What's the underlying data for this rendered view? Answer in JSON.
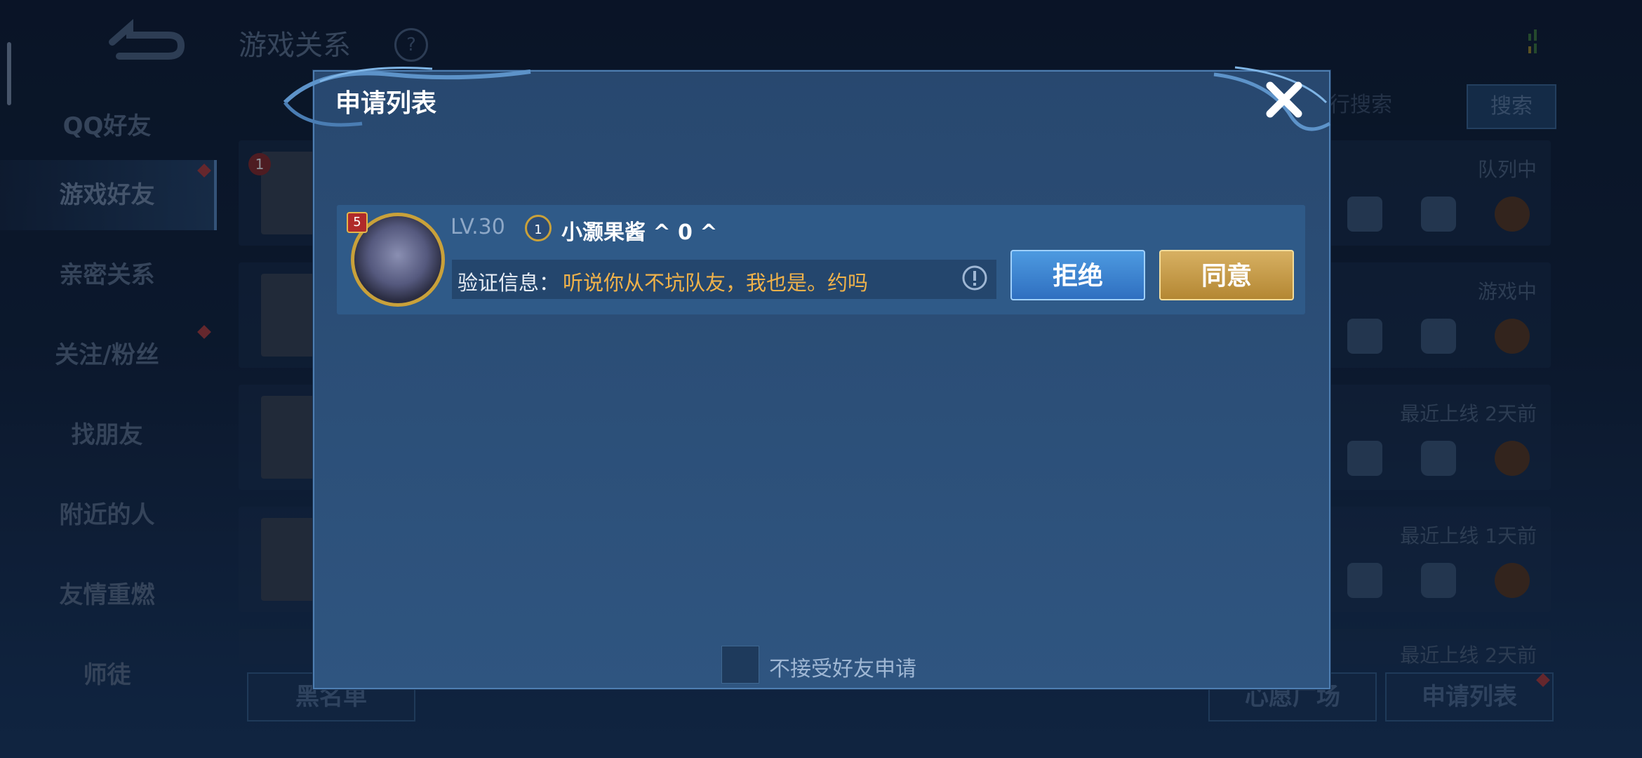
{
  "background": {
    "page_title": "游戏关系",
    "help_icon_text": "?",
    "sidebar": [
      {
        "label": "QQ好友"
      },
      {
        "label": "游戏好友",
        "active": true
      },
      {
        "label": "亲密关系"
      },
      {
        "label": "关注/粉丝"
      },
      {
        "label": "找朋友"
      },
      {
        "label": "附近的人"
      },
      {
        "label": "友情重燃"
      },
      {
        "label": "师徒"
      }
    ],
    "search_placeholder": "行搜索",
    "search_button": "搜索",
    "friend_rank_badge": "1",
    "friends": [
      {
        "status": "队列中"
      },
      {
        "status": "游戏中"
      },
      {
        "status": "最近上线  2天前"
      },
      {
        "status": "最近上线  1天前"
      },
      {
        "status": "最近上线  2天前"
      }
    ],
    "bottom_buttons": {
      "blacklist": "黑名单",
      "wish_square": "心愿广场",
      "apply_list": "申请列表"
    }
  },
  "dialog": {
    "title": "申请列表",
    "request": {
      "avatar_badge": "5",
      "level": "LV.30",
      "rank_badge": "1",
      "name": "小灏果酱 ^ 0 ^",
      "verify_label": "验证信息：",
      "verify_message": "听说你从不坑队友，我也是。约吗",
      "reject_label": "拒绝",
      "accept_label": "同意"
    },
    "no_requests_label": "不接受好友申请"
  },
  "colors": {
    "accept": "#c79b48",
    "reject": "#3b82d0",
    "message": "#f0b24a"
  }
}
